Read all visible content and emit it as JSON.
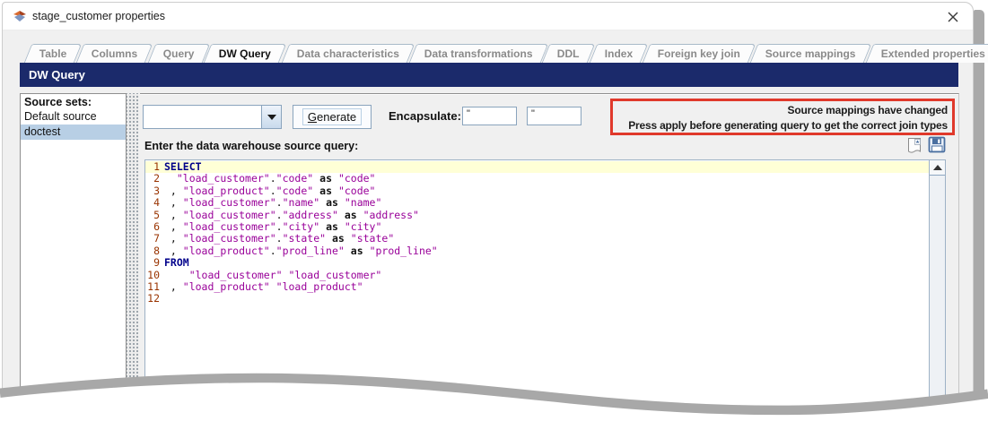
{
  "window": {
    "title": "stage_customer properties",
    "close_icon": "x-close-icon"
  },
  "tabs": {
    "items": [
      {
        "label": "Table",
        "active": false
      },
      {
        "label": "Columns",
        "active": false
      },
      {
        "label": "Query",
        "active": false
      },
      {
        "label": "DW Query",
        "active": true
      },
      {
        "label": "Data characteristics",
        "active": false
      },
      {
        "label": "Data transformations",
        "active": false
      },
      {
        "label": "DDL",
        "active": false
      },
      {
        "label": "Index",
        "active": false
      },
      {
        "label": "Foreign key join",
        "active": false
      },
      {
        "label": "Source mappings",
        "active": false
      },
      {
        "label": "Extended properties",
        "active": false
      }
    ]
  },
  "section_header": {
    "title": "DW Query"
  },
  "source_sets": {
    "label": "Source sets:",
    "items": [
      {
        "label": "Default source",
        "selected": false
      },
      {
        "label": "doctest",
        "selected": true
      }
    ],
    "selected_color": "#b8cfe5"
  },
  "toolbar": {
    "combo_value": "",
    "generate_label": "Generate",
    "encapsulate_label": "Encapsulate:",
    "open_quote_value": "\"",
    "close_quote_value": "\""
  },
  "warning": {
    "line1": "Source mappings have changed",
    "line2": "Press apply before generating query to get the correct join types",
    "border_color": "#e0392b"
  },
  "editor": {
    "label": "Enter the data warehouse source query:",
    "icons": [
      "new-query-icon",
      "save-icon"
    ],
    "colors": {
      "keyword": "#00008b",
      "identifier": "#990099",
      "line_number": "#993300",
      "current_line_bg": "#ffffd6"
    },
    "lines": [
      {
        "n": "1",
        "hl": true,
        "toks": [
          {
            "t": "kw",
            "s": "SELECT"
          }
        ]
      },
      {
        "n": "2",
        "toks": [
          {
            "t": "pl",
            "s": "  "
          },
          {
            "t": "id",
            "s": "\"load_customer\""
          },
          {
            "t": "pl",
            "s": "."
          },
          {
            "t": "id",
            "s": "\"code\""
          },
          {
            "t": "pl",
            "s": " "
          },
          {
            "t": "as",
            "s": "as"
          },
          {
            "t": "pl",
            "s": " "
          },
          {
            "t": "id",
            "s": "\"code\""
          }
        ]
      },
      {
        "n": "3",
        "toks": [
          {
            "t": "pl",
            "s": " , "
          },
          {
            "t": "id",
            "s": "\"load_product\""
          },
          {
            "t": "pl",
            "s": "."
          },
          {
            "t": "id",
            "s": "\"code\""
          },
          {
            "t": "pl",
            "s": " "
          },
          {
            "t": "as",
            "s": "as"
          },
          {
            "t": "pl",
            "s": " "
          },
          {
            "t": "id",
            "s": "\"code\""
          }
        ]
      },
      {
        "n": "4",
        "toks": [
          {
            "t": "pl",
            "s": " , "
          },
          {
            "t": "id",
            "s": "\"load_customer\""
          },
          {
            "t": "pl",
            "s": "."
          },
          {
            "t": "id",
            "s": "\"name\""
          },
          {
            "t": "pl",
            "s": " "
          },
          {
            "t": "as",
            "s": "as"
          },
          {
            "t": "pl",
            "s": " "
          },
          {
            "t": "id",
            "s": "\"name\""
          }
        ]
      },
      {
        "n": "5",
        "toks": [
          {
            "t": "pl",
            "s": " , "
          },
          {
            "t": "id",
            "s": "\"load_customer\""
          },
          {
            "t": "pl",
            "s": "."
          },
          {
            "t": "id",
            "s": "\"address\""
          },
          {
            "t": "pl",
            "s": " "
          },
          {
            "t": "as",
            "s": "as"
          },
          {
            "t": "pl",
            "s": " "
          },
          {
            "t": "id",
            "s": "\"address\""
          }
        ]
      },
      {
        "n": "6",
        "toks": [
          {
            "t": "pl",
            "s": " , "
          },
          {
            "t": "id",
            "s": "\"load_customer\""
          },
          {
            "t": "pl",
            "s": "."
          },
          {
            "t": "id",
            "s": "\"city\""
          },
          {
            "t": "pl",
            "s": " "
          },
          {
            "t": "as",
            "s": "as"
          },
          {
            "t": "pl",
            "s": " "
          },
          {
            "t": "id",
            "s": "\"city\""
          }
        ]
      },
      {
        "n": "7",
        "toks": [
          {
            "t": "pl",
            "s": " , "
          },
          {
            "t": "id",
            "s": "\"load_customer\""
          },
          {
            "t": "pl",
            "s": "."
          },
          {
            "t": "id",
            "s": "\"state\""
          },
          {
            "t": "pl",
            "s": " "
          },
          {
            "t": "as",
            "s": "as"
          },
          {
            "t": "pl",
            "s": " "
          },
          {
            "t": "id",
            "s": "\"state\""
          }
        ]
      },
      {
        "n": "8",
        "toks": [
          {
            "t": "pl",
            "s": " , "
          },
          {
            "t": "id",
            "s": "\"load_product\""
          },
          {
            "t": "pl",
            "s": "."
          },
          {
            "t": "id",
            "s": "\"prod_line\""
          },
          {
            "t": "pl",
            "s": " "
          },
          {
            "t": "as",
            "s": "as"
          },
          {
            "t": "pl",
            "s": " "
          },
          {
            "t": "id",
            "s": "\"prod_line\""
          }
        ]
      },
      {
        "n": "9",
        "toks": [
          {
            "t": "kw",
            "s": "FROM"
          }
        ]
      },
      {
        "n": "10",
        "toks": [
          {
            "t": "pl",
            "s": "    "
          },
          {
            "t": "id",
            "s": "\"load_customer\""
          },
          {
            "t": "pl",
            "s": " "
          },
          {
            "t": "id",
            "s": "\"load_customer\""
          }
        ]
      },
      {
        "n": "11",
        "toks": [
          {
            "t": "pl",
            "s": " , "
          },
          {
            "t": "id",
            "s": "\"load_product\""
          },
          {
            "t": "pl",
            "s": " "
          },
          {
            "t": "id",
            "s": "\"load_product\""
          }
        ]
      },
      {
        "n": "12",
        "toks": []
      }
    ]
  }
}
